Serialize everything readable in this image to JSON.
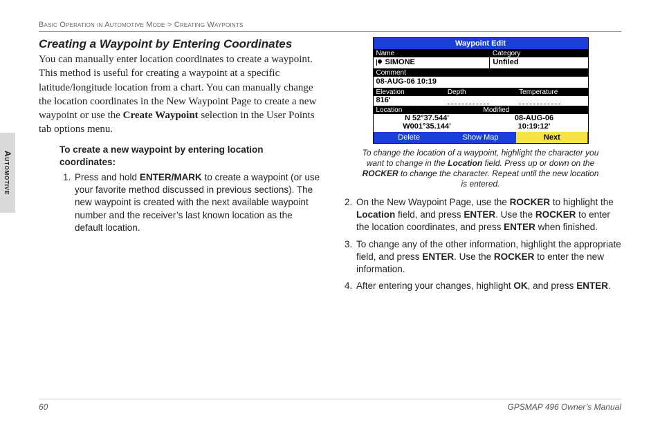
{
  "breadcrumb": {
    "section": "Basic Operation in Automotive Mode",
    "sep": ">",
    "sub": "Creating Waypoints"
  },
  "side_tab": "Automotive",
  "footer": {
    "page": "60",
    "manual": "GPSMAP 496 Owner’s Manual"
  },
  "left": {
    "heading": "Creating a Waypoint by Entering Coordinates",
    "para": {
      "t1": "You can manually enter location coordinates to create a waypoint. This method is useful for creating a waypoint at a specific latitude/longitude location from a chart. You can manually change the location coordinates in the New Waypoint Page to create a new waypoint or use the ",
      "b1": "Create Waypoint",
      "t2": " selection in the User Points tab options menu."
    },
    "lead": "To create a new waypoint by entering location coordinates:",
    "step1": {
      "t1": "Press and hold ",
      "b1": "ENTER/MARK",
      "t2": " to create a waypoint (or use your favorite method discussed in previous sections). The new waypoint is created with the next available waypoint number and the receiver’s last known location as the default location."
    }
  },
  "device": {
    "title": "Waypoint Edit",
    "labels": {
      "name": "Name",
      "category": "Category",
      "comment": "Comment",
      "elevation": "Elevation",
      "depth": "Depth",
      "temperature": "Temperature",
      "location": "Location",
      "modified": "Modified"
    },
    "values": {
      "name": "SIMONE",
      "category": "Unfiled",
      "comment": "08-AUG-06 10:19",
      "elevation": "816'",
      "depth": "",
      "temperature": "",
      "lat": "N  52°37.544'",
      "lon": "W001°35.144'",
      "mod_date": "08-AUG-06",
      "mod_time": "10:19:12'"
    },
    "buttons": {
      "delete": "Delete",
      "showmap": "Show Map",
      "next": "Next"
    }
  },
  "caption": {
    "t1": "To change the location of a waypoint, highlight the character you want to change in the ",
    "b1": "Location",
    "t2": " field. Press up or down on the ",
    "b2": "ROCKER",
    "t3": " to change the character. Repeat until the new location is entered."
  },
  "right": {
    "step2": {
      "t1": "On the New Waypoint Page, use the ",
      "b1": "ROCKER",
      "t2": " to highlight the ",
      "b2": "Location",
      "t3": " field, and press ",
      "b3": "ENTER",
      "t4": ". Use the ",
      "b4": "ROCKER",
      "t5": " to enter the location coordinates, and press ",
      "b5": "ENTER",
      "t6": " when finished."
    },
    "step3": {
      "t1": "To change any of the other information, highlight the appropriate field, and press ",
      "b1": "ENTER",
      "t2": ". Use the ",
      "b2": "ROCKER",
      "t3": " to enter the new information."
    },
    "step4": {
      "t1": "After entering your changes, highlight ",
      "b1": "OK",
      "t2": ", and press ",
      "b2": "ENTER",
      "t3": "."
    }
  }
}
